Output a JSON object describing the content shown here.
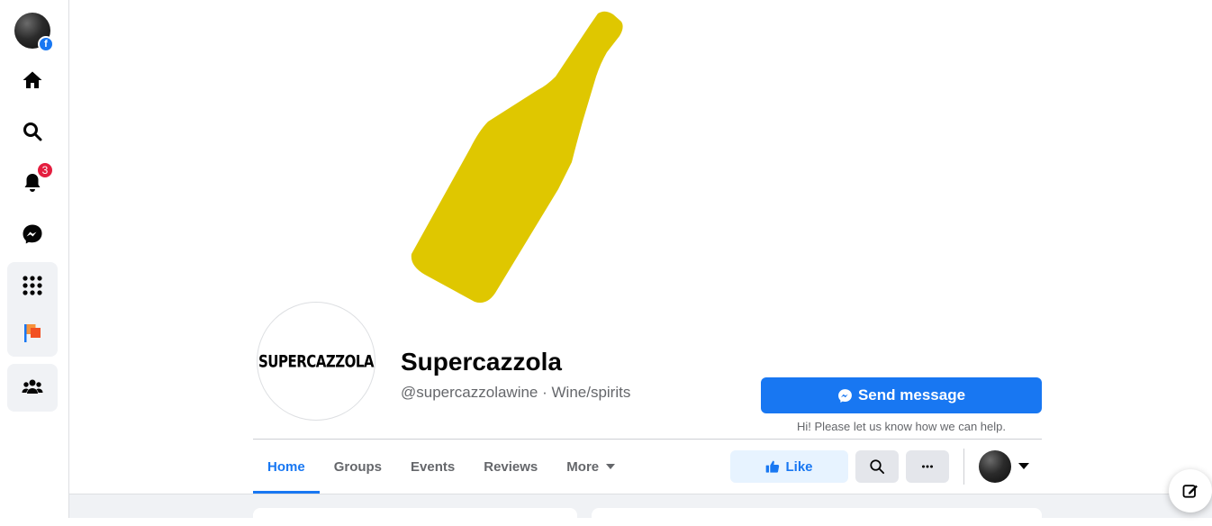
{
  "sidebar": {
    "notifications_count": "3",
    "fb_badge": "f",
    "icons": [
      "home-icon",
      "search-icon",
      "bell-icon",
      "messenger-icon",
      "grid-menu-icon",
      "pages-flag-icon",
      "groups-icon"
    ]
  },
  "page": {
    "name": "Supercazzola",
    "meta": "@supercazzolawine · Wine/spirits",
    "profile_logo_text": "SUPERCAZZOLA",
    "cover_color": "#dfc700"
  },
  "actions": {
    "send_message_label": "Send message",
    "send_message_hint": "Hi! Please let us know how we can help.",
    "like_label": "Like"
  },
  "tabs": [
    {
      "label": "Home",
      "active": true
    },
    {
      "label": "Groups",
      "active": false
    },
    {
      "label": "Events",
      "active": false
    },
    {
      "label": "Reviews",
      "active": false
    },
    {
      "label": "More",
      "active": false
    }
  ],
  "colors": {
    "accent": "#1877f2",
    "badge": "#e41e3f"
  }
}
